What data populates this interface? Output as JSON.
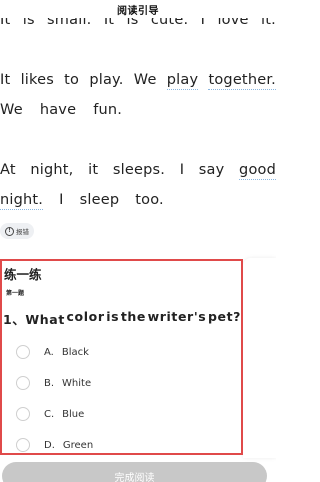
{
  "header": {
    "title": "阅读引导"
  },
  "reading": {
    "lines": [
      [
        "It",
        "is",
        "small.",
        "It",
        "is",
        "cute.",
        "I",
        "love",
        "it."
      ],
      [
        "It",
        "likes",
        "to",
        "play.",
        "We",
        "play",
        "together."
      ],
      [
        "We",
        "have",
        "fun."
      ],
      [
        "At",
        "night,",
        "it",
        "sleeps.",
        "I",
        "say",
        "good"
      ],
      [
        "night.",
        "I",
        "sleep",
        "too."
      ]
    ]
  },
  "report": {
    "label": "报错"
  },
  "practice": {
    "heading": "练一练",
    "question_number": "第一题",
    "question_words": [
      "1、What",
      "color",
      "is",
      "the",
      "writer's",
      "pet?"
    ],
    "options": [
      {
        "letter": "A.",
        "text": "Black"
      },
      {
        "letter": "B.",
        "text": "White"
      },
      {
        "letter": "C.",
        "text": "Blue"
      },
      {
        "letter": "D.",
        "text": "Green"
      }
    ]
  },
  "footer": {
    "finish_label": "完成阅读"
  },
  "colors": {
    "highlight_frame": "#e04a4a",
    "underline": "#8ab6e0",
    "finish_button": "#c8c8c8"
  }
}
